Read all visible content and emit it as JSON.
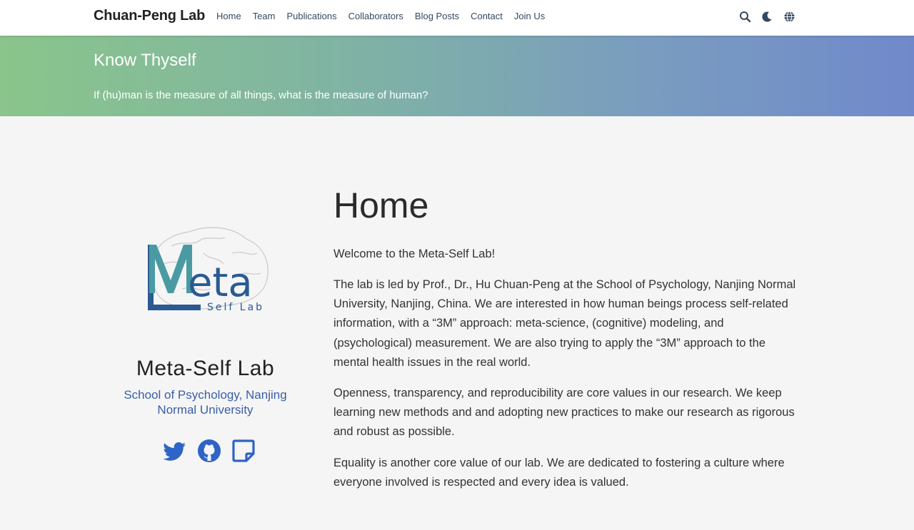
{
  "navbar": {
    "brand": "Chuan-Peng Lab",
    "links": [
      "Home",
      "Team",
      "Publications",
      "Collaborators",
      "Blog Posts",
      "Contact",
      "Join Us"
    ],
    "icons": [
      "search-icon",
      "moon-icon",
      "globe-icon"
    ]
  },
  "hero": {
    "title": "Know Thyself",
    "subtitle": "If (hu)man is the measure of all things, what is the measure of human?"
  },
  "profile": {
    "logo_letters": "eta",
    "logo_M": "M",
    "logo_L": "L",
    "logo_tagline": "Self Lab",
    "name": "Meta-Self Lab",
    "affiliation": "School of Psychology, Nanjing Normal University",
    "socials": [
      "twitter-icon",
      "github-icon",
      "notes-icon"
    ],
    "accent_color": "#2e63c7"
  },
  "main": {
    "title": "Home",
    "paragraphs": [
      "Welcome to the Meta-Self Lab!",
      "The lab is led by Prof., Dr., Hu Chuan-Peng at the School of Psychology, Nanjing Normal University, Nanjing, China. We are interested in how human beings process self-related information, with a “3M” approach: meta-science, (cognitive) modeling, and (psychological) measurement. We are also trying to apply the “3M” approach to the mental health issues in the real world.",
      "Openness, transparency, and reproducibility are core values in our research. We keep learning new methods and and adopting new practices to make our research as rigorous and robust as possible.",
      "Equality is another core value of our lab. We are dedicated to fostering a culture where everyone involved is respected and every idea is valued."
    ]
  }
}
